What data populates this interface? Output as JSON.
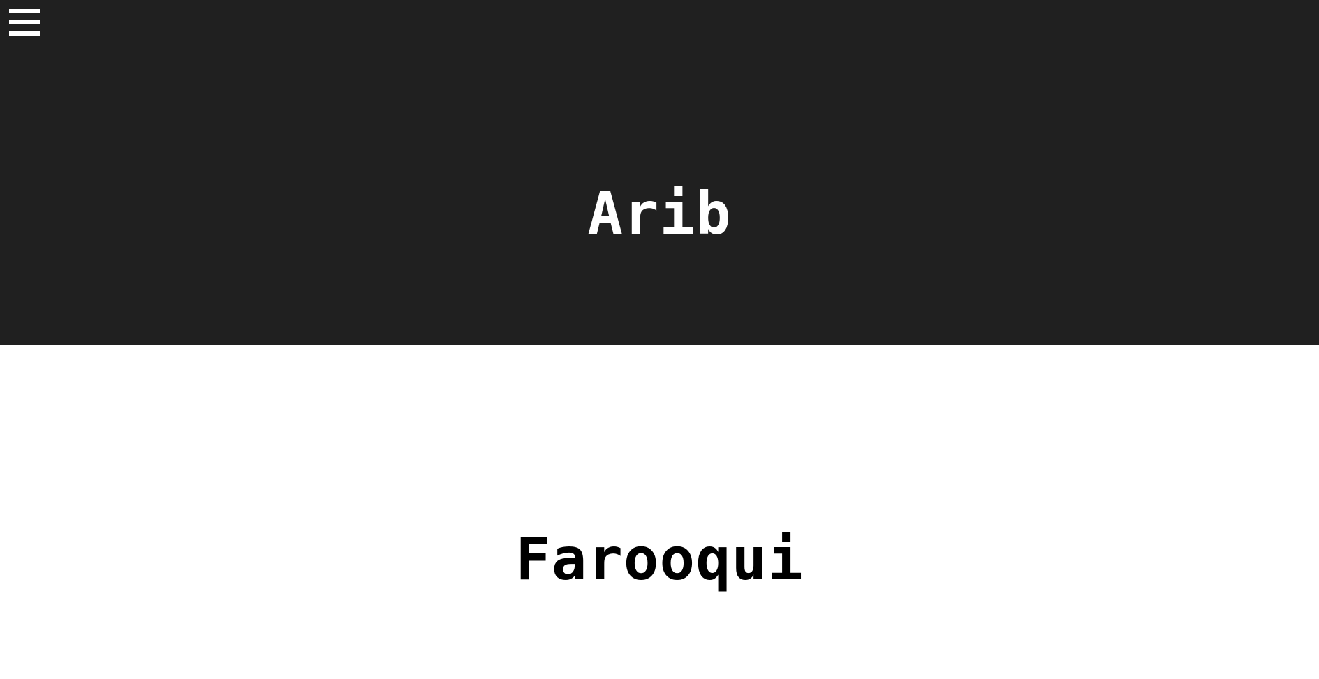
{
  "menu": {
    "icon": "hamburger-menu-icon",
    "color": "#ffffff"
  },
  "hero": {
    "first_name": "Arib",
    "last_name": "Farooqui",
    "top_background": "#202020",
    "bottom_background": "#ffffff"
  }
}
